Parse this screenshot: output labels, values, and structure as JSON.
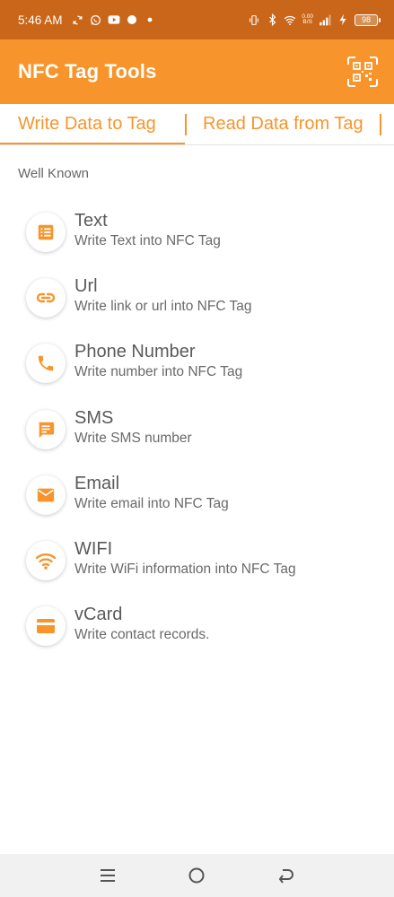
{
  "status_bar": {
    "time": "5:46 AM",
    "net_speed_top": "0.00",
    "net_speed_bottom": "B/S",
    "battery": "98",
    "icons": [
      "sync-icon",
      "whatsapp-icon",
      "youtube-icon",
      "circle-icon",
      "dot-icon",
      "vibrate-icon",
      "bluetooth-icon",
      "wifi-icon",
      "signal-icon",
      "charging-icon"
    ]
  },
  "app_bar": {
    "title": "NFC Tag Tools",
    "action_icon": "qr-scan-icon"
  },
  "tabs": [
    {
      "label": "Write Data to Tag",
      "active": true
    },
    {
      "label": "Read Data from Tag",
      "active": false
    }
  ],
  "section": {
    "label": "Well Known"
  },
  "items": [
    {
      "title": "Text",
      "subtitle": "Write Text into NFC Tag",
      "icon": "text-icon"
    },
    {
      "title": "Url",
      "subtitle": "Write link or url into NFC Tag",
      "icon": "link-icon"
    },
    {
      "title": "Phone Number",
      "subtitle": "Write number into NFC Tag",
      "icon": "phone-icon"
    },
    {
      "title": "SMS",
      "subtitle": "Write SMS number",
      "icon": "sms-icon"
    },
    {
      "title": "Email",
      "subtitle": "Write email into NFC Tag",
      "icon": "email-icon"
    },
    {
      "title": "WIFI",
      "subtitle": "Write WiFi information into NFC Tag",
      "icon": "wifi-icon"
    },
    {
      "title": "vCard",
      "subtitle": "Write contact records.",
      "icon": "vcard-icon"
    }
  ],
  "nav_bar": {
    "buttons": [
      "menu-icon",
      "home-icon",
      "back-icon"
    ]
  },
  "colors": {
    "status_bar": "#c9661a",
    "accent": "#f7952c",
    "nav_bar": "#f1f1f1"
  }
}
